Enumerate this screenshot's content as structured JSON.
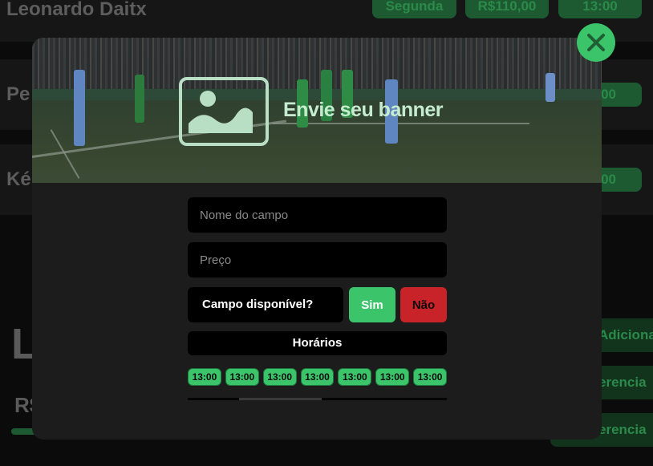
{
  "background_page": {
    "rows": [
      {
        "name": "Leonardo Daitx",
        "day": "Segunda",
        "price": "R$110,00",
        "time": "13:00"
      },
      {
        "name": "Pe",
        "time": "00"
      },
      {
        "name": "Ké",
        "time": "00"
      }
    ],
    "big_heading": "L",
    "price_label": "R$",
    "side_buttons": [
      "Adiciona",
      "erencia",
      "erencia"
    ]
  },
  "modal": {
    "banner": {
      "title": "Envie seu banner",
      "icon": "image-icon"
    },
    "fields": {
      "name_placeholder": "Nome do campo",
      "price_placeholder": "Preço"
    },
    "availability": {
      "label": "Campo disponível?",
      "yes_label": "Sim",
      "no_label": "Não"
    },
    "hours": {
      "title": "Horários",
      "slots": [
        "13:00",
        "13:00",
        "13:00",
        "13:00",
        "13:00",
        "13:00",
        "13:00"
      ]
    },
    "close_icon": "close-icon"
  },
  "colors": {
    "accent_green": "#3bc46a",
    "danger_red": "#c9232a",
    "banner_text": "#c6ecd0",
    "modal_bg": "#1c1c1c"
  }
}
